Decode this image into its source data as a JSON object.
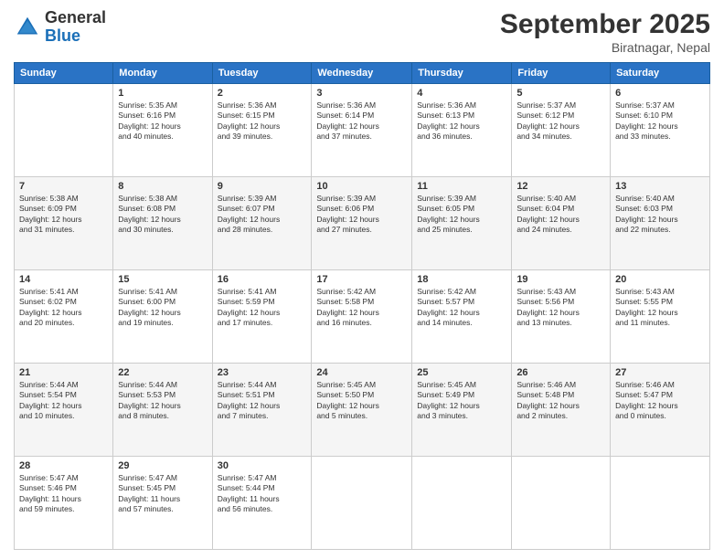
{
  "header": {
    "logo_general": "General",
    "logo_blue": "Blue",
    "month": "September 2025",
    "location": "Biratnagar, Nepal"
  },
  "days_of_week": [
    "Sunday",
    "Monday",
    "Tuesday",
    "Wednesday",
    "Thursday",
    "Friday",
    "Saturday"
  ],
  "weeks": [
    [
      {
        "num": "",
        "info": ""
      },
      {
        "num": "1",
        "info": "Sunrise: 5:35 AM\nSunset: 6:16 PM\nDaylight: 12 hours\nand 40 minutes."
      },
      {
        "num": "2",
        "info": "Sunrise: 5:36 AM\nSunset: 6:15 PM\nDaylight: 12 hours\nand 39 minutes."
      },
      {
        "num": "3",
        "info": "Sunrise: 5:36 AM\nSunset: 6:14 PM\nDaylight: 12 hours\nand 37 minutes."
      },
      {
        "num": "4",
        "info": "Sunrise: 5:36 AM\nSunset: 6:13 PM\nDaylight: 12 hours\nand 36 minutes."
      },
      {
        "num": "5",
        "info": "Sunrise: 5:37 AM\nSunset: 6:12 PM\nDaylight: 12 hours\nand 34 minutes."
      },
      {
        "num": "6",
        "info": "Sunrise: 5:37 AM\nSunset: 6:10 PM\nDaylight: 12 hours\nand 33 minutes."
      }
    ],
    [
      {
        "num": "7",
        "info": "Sunrise: 5:38 AM\nSunset: 6:09 PM\nDaylight: 12 hours\nand 31 minutes."
      },
      {
        "num": "8",
        "info": "Sunrise: 5:38 AM\nSunset: 6:08 PM\nDaylight: 12 hours\nand 30 minutes."
      },
      {
        "num": "9",
        "info": "Sunrise: 5:39 AM\nSunset: 6:07 PM\nDaylight: 12 hours\nand 28 minutes."
      },
      {
        "num": "10",
        "info": "Sunrise: 5:39 AM\nSunset: 6:06 PM\nDaylight: 12 hours\nand 27 minutes."
      },
      {
        "num": "11",
        "info": "Sunrise: 5:39 AM\nSunset: 6:05 PM\nDaylight: 12 hours\nand 25 minutes."
      },
      {
        "num": "12",
        "info": "Sunrise: 5:40 AM\nSunset: 6:04 PM\nDaylight: 12 hours\nand 24 minutes."
      },
      {
        "num": "13",
        "info": "Sunrise: 5:40 AM\nSunset: 6:03 PM\nDaylight: 12 hours\nand 22 minutes."
      }
    ],
    [
      {
        "num": "14",
        "info": "Sunrise: 5:41 AM\nSunset: 6:02 PM\nDaylight: 12 hours\nand 20 minutes."
      },
      {
        "num": "15",
        "info": "Sunrise: 5:41 AM\nSunset: 6:00 PM\nDaylight: 12 hours\nand 19 minutes."
      },
      {
        "num": "16",
        "info": "Sunrise: 5:41 AM\nSunset: 5:59 PM\nDaylight: 12 hours\nand 17 minutes."
      },
      {
        "num": "17",
        "info": "Sunrise: 5:42 AM\nSunset: 5:58 PM\nDaylight: 12 hours\nand 16 minutes."
      },
      {
        "num": "18",
        "info": "Sunrise: 5:42 AM\nSunset: 5:57 PM\nDaylight: 12 hours\nand 14 minutes."
      },
      {
        "num": "19",
        "info": "Sunrise: 5:43 AM\nSunset: 5:56 PM\nDaylight: 12 hours\nand 13 minutes."
      },
      {
        "num": "20",
        "info": "Sunrise: 5:43 AM\nSunset: 5:55 PM\nDaylight: 12 hours\nand 11 minutes."
      }
    ],
    [
      {
        "num": "21",
        "info": "Sunrise: 5:44 AM\nSunset: 5:54 PM\nDaylight: 12 hours\nand 10 minutes."
      },
      {
        "num": "22",
        "info": "Sunrise: 5:44 AM\nSunset: 5:53 PM\nDaylight: 12 hours\nand 8 minutes."
      },
      {
        "num": "23",
        "info": "Sunrise: 5:44 AM\nSunset: 5:51 PM\nDaylight: 12 hours\nand 7 minutes."
      },
      {
        "num": "24",
        "info": "Sunrise: 5:45 AM\nSunset: 5:50 PM\nDaylight: 12 hours\nand 5 minutes."
      },
      {
        "num": "25",
        "info": "Sunrise: 5:45 AM\nSunset: 5:49 PM\nDaylight: 12 hours\nand 3 minutes."
      },
      {
        "num": "26",
        "info": "Sunrise: 5:46 AM\nSunset: 5:48 PM\nDaylight: 12 hours\nand 2 minutes."
      },
      {
        "num": "27",
        "info": "Sunrise: 5:46 AM\nSunset: 5:47 PM\nDaylight: 12 hours\nand 0 minutes."
      }
    ],
    [
      {
        "num": "28",
        "info": "Sunrise: 5:47 AM\nSunset: 5:46 PM\nDaylight: 11 hours\nand 59 minutes."
      },
      {
        "num": "29",
        "info": "Sunrise: 5:47 AM\nSunset: 5:45 PM\nDaylight: 11 hours\nand 57 minutes."
      },
      {
        "num": "30",
        "info": "Sunrise: 5:47 AM\nSunset: 5:44 PM\nDaylight: 11 hours\nand 56 minutes."
      },
      {
        "num": "",
        "info": ""
      },
      {
        "num": "",
        "info": ""
      },
      {
        "num": "",
        "info": ""
      },
      {
        "num": "",
        "info": ""
      }
    ]
  ]
}
